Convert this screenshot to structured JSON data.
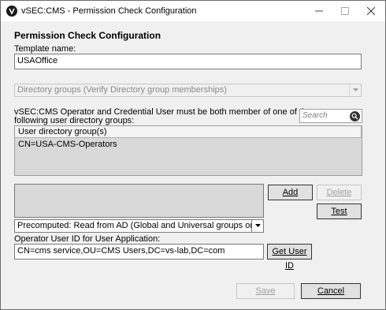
{
  "window": {
    "title": "vSEC:CMS - Permission Check Configuration"
  },
  "form": {
    "heading": "Permission Check Configuration",
    "template_name_label": "Template name:",
    "template_name_value": "USAOffice",
    "group_source_select": "Directory groups (Verify Directory group memberships)",
    "membership_text_line1": "vSEC:CMS Operator and Credential User must be both member of one of the",
    "membership_text_line2": "following user directory groups:",
    "search_placeholder": "Search",
    "groups_list": {
      "column_header": "User directory group(s)",
      "rows": [
        "CN=USA-CMS-Operators"
      ]
    },
    "add_button": "Add",
    "delete_button": "Delete",
    "test_button": "Test",
    "precomputed_select": "Precomputed: Read from AD (Global and Universal groups only)",
    "operator_id_label": "Operator User ID for User Application:",
    "operator_id_value": "CN=cms service,OU=CMS Users,DC=vs-lab,DC=com",
    "get_user_id_button": "Get User ID",
    "save_button": "Save",
    "cancel_button": "Cancel"
  }
}
